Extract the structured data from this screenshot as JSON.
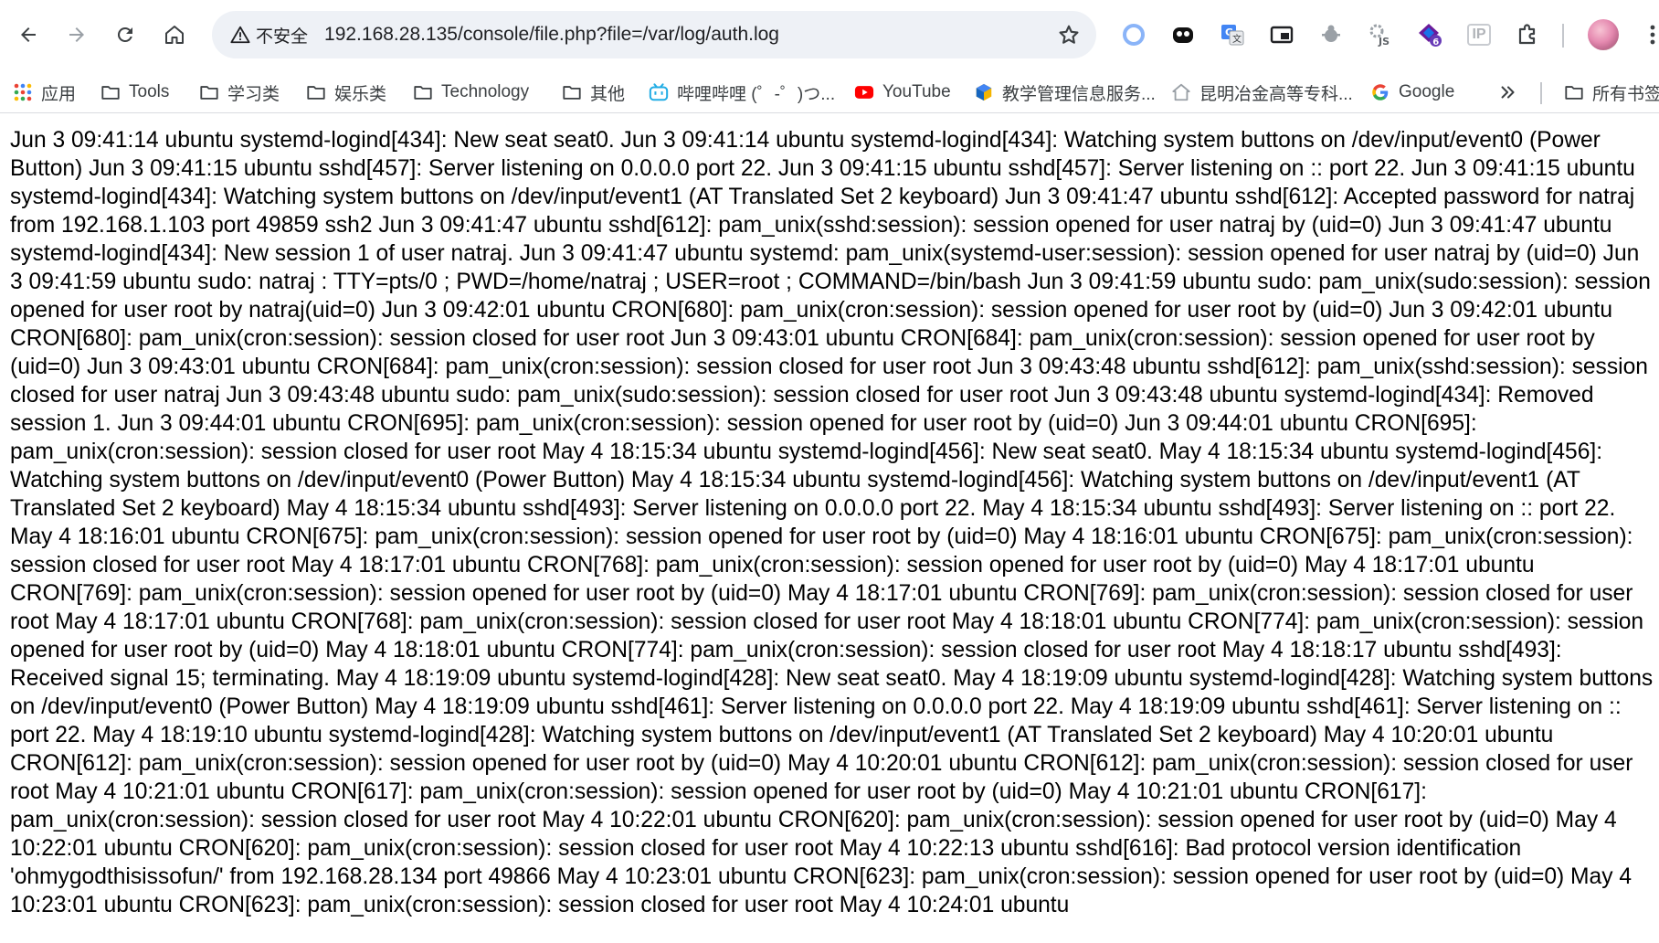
{
  "browser": {
    "security_label": "不安全",
    "url": "192.168.28.135/console/file.php?file=/var/log/auth.log",
    "extension_badge": "6",
    "ip_ext_label": "IP"
  },
  "bookmarks": [
    {
      "label": "应用",
      "icon": "apps-grid-icon"
    },
    {
      "label": "Tools",
      "icon": "folder-icon"
    },
    {
      "label": "学习类",
      "icon": "folder-icon"
    },
    {
      "label": "娱乐类",
      "icon": "folder-icon"
    },
    {
      "label": "Technology",
      "icon": "folder-icon"
    },
    {
      "label": "其他",
      "icon": "folder-icon"
    },
    {
      "label": "哔哩哔哩 (゜-゜)つ...",
      "icon": "bilibili-icon"
    },
    {
      "label": "YouTube",
      "icon": "youtube-icon"
    },
    {
      "label": "教学管理信息服务...",
      "icon": "cube-icon"
    },
    {
      "label": "昆明冶金高等专科...",
      "icon": "house-icon"
    },
    {
      "label": "Google",
      "icon": "google-icon"
    },
    {
      "label": "所有书签",
      "icon": "folder-icon"
    }
  ],
  "colors": {
    "youtube": "#ff0000",
    "google_blue": "#4285f4",
    "bilibili": "#23ade5",
    "apps_red": "#ea4335"
  },
  "log": {
    "text": "Jun 3 09:41:14 ubuntu systemd-logind[434]: New seat seat0. Jun 3 09:41:14 ubuntu systemd-logind[434]: Watching system buttons on /dev/input/event0 (Power Button) Jun 3 09:41:15 ubuntu sshd[457]: Server listening on 0.0.0.0 port 22. Jun 3 09:41:15 ubuntu sshd[457]: Server listening on :: port 22. Jun 3 09:41:15 ubuntu systemd-logind[434]: Watching system buttons on /dev/input/event1 (AT Translated Set 2 keyboard) Jun 3 09:41:47 ubuntu sshd[612]: Accepted password for natraj from 192.168.1.103 port 49859 ssh2 Jun 3 09:41:47 ubuntu sshd[612]: pam_unix(sshd:session): session opened for user natraj by (uid=0) Jun 3 09:41:47 ubuntu systemd-logind[434]: New session 1 of user natraj. Jun 3 09:41:47 ubuntu systemd: pam_unix(systemd-user:session): session opened for user natraj by (uid=0) Jun 3 09:41:59 ubuntu sudo: natraj : TTY=pts/0 ; PWD=/home/natraj ; USER=root ; COMMAND=/bin/bash Jun 3 09:41:59 ubuntu sudo: pam_unix(sudo:session): session opened for user root by natraj(uid=0) Jun 3 09:42:01 ubuntu CRON[680]: pam_unix(cron:session): session opened for user root by (uid=0) Jun 3 09:42:01 ubuntu CRON[680]: pam_unix(cron:session): session closed for user root Jun 3 09:43:01 ubuntu CRON[684]: pam_unix(cron:session): session opened for user root by (uid=0) Jun 3 09:43:01 ubuntu CRON[684]: pam_unix(cron:session): session closed for user root Jun 3 09:43:48 ubuntu sshd[612]: pam_unix(sshd:session): session closed for user natraj Jun 3 09:43:48 ubuntu sudo: pam_unix(sudo:session): session closed for user root Jun 3 09:43:48 ubuntu systemd-logind[434]: Removed session 1. Jun 3 09:44:01 ubuntu CRON[695]: pam_unix(cron:session): session opened for user root by (uid=0) Jun 3 09:44:01 ubuntu CRON[695]: pam_unix(cron:session): session closed for user root May 4 18:15:34 ubuntu systemd-logind[456]: New seat seat0. May 4 18:15:34 ubuntu systemd-logind[456]: Watching system buttons on /dev/input/event0 (Power Button) May 4 18:15:34 ubuntu systemd-logind[456]: Watching system buttons on /dev/input/event1 (AT Translated Set 2 keyboard) May 4 18:15:34 ubuntu sshd[493]: Server listening on 0.0.0.0 port 22. May 4 18:15:34 ubuntu sshd[493]: Server listening on :: port 22. May 4 18:16:01 ubuntu CRON[675]: pam_unix(cron:session): session opened for user root by (uid=0) May 4 18:16:01 ubuntu CRON[675]: pam_unix(cron:session): session closed for user root May 4 18:17:01 ubuntu CRON[768]: pam_unix(cron:session): session opened for user root by (uid=0) May 4 18:17:01 ubuntu CRON[769]: pam_unix(cron:session): session opened for user root by (uid=0) May 4 18:17:01 ubuntu CRON[769]: pam_unix(cron:session): session closed for user root May 4 18:17:01 ubuntu CRON[768]: pam_unix(cron:session): session closed for user root May 4 18:18:01 ubuntu CRON[774]: pam_unix(cron:session): session opened for user root by (uid=0) May 4 18:18:01 ubuntu CRON[774]: pam_unix(cron:session): session closed for user root May 4 18:18:17 ubuntu sshd[493]: Received signal 15; terminating. May 4 18:19:09 ubuntu systemd-logind[428]: New seat seat0. May 4 18:19:09 ubuntu systemd-logind[428]: Watching system buttons on /dev/input/event0 (Power Button) May 4 18:19:09 ubuntu sshd[461]: Server listening on 0.0.0.0 port 22. May 4 18:19:09 ubuntu sshd[461]: Server listening on :: port 22. May 4 18:19:10 ubuntu systemd-logind[428]: Watching system buttons on /dev/input/event1 (AT Translated Set 2 keyboard) May 4 10:20:01 ubuntu CRON[612]: pam_unix(cron:session): session opened for user root by (uid=0) May 4 10:20:01 ubuntu CRON[612]: pam_unix(cron:session): session closed for user root May 4 10:21:01 ubuntu CRON[617]: pam_unix(cron:session): session opened for user root by (uid=0) May 4 10:21:01 ubuntu CRON[617]: pam_unix(cron:session): session closed for user root May 4 10:22:01 ubuntu CRON[620]: pam_unix(cron:session): session opened for user root by (uid=0) May 4 10:22:01 ubuntu CRON[620]: pam_unix(cron:session): session closed for user root May 4 10:22:13 ubuntu sshd[616]: Bad protocol version identification 'ohmygodthisissofun/' from 192.168.28.134 port 49866 May 4 10:23:01 ubuntu CRON[623]: pam_unix(cron:session): session opened for user root by (uid=0) May 4 10:23:01 ubuntu CRON[623]: pam_unix(cron:session): session closed for user root May 4 10:24:01 ubuntu"
  }
}
